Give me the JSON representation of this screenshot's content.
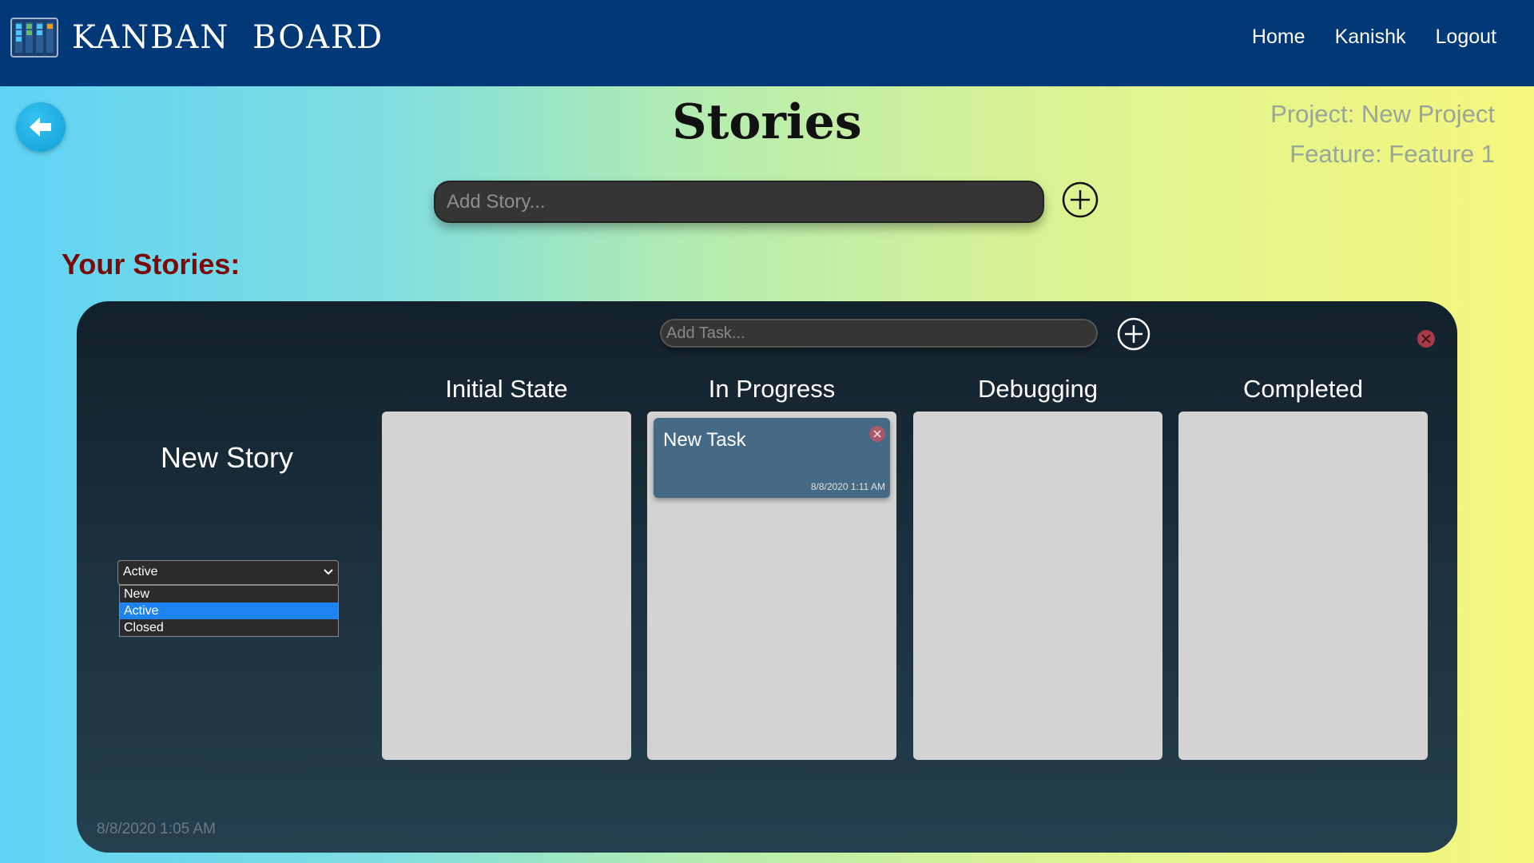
{
  "app": {
    "brand": "KANBAN BOARD",
    "nav": [
      {
        "label": "Home"
      },
      {
        "label": "Kanishk"
      },
      {
        "label": "Logout"
      }
    ]
  },
  "page": {
    "title": "Stories",
    "project": "Project: New Project",
    "feature": "Feature: Feature 1",
    "story_input_placeholder": "Add Story...",
    "section_heading": "Your Stories:"
  },
  "story": {
    "name": "New Story",
    "task_input_placeholder": "Add Task...",
    "status": {
      "selected": "Active",
      "options": [
        "New",
        "Active",
        "Closed"
      ]
    },
    "columns": [
      {
        "title": "Initial State"
      },
      {
        "title": "In Progress"
      },
      {
        "title": "Debugging"
      },
      {
        "title": "Completed"
      }
    ],
    "task": {
      "title": "New Task",
      "date": "8/8/2020 1:11 AM"
    },
    "created": "8/8/2020 1:05 AM"
  },
  "colors": {
    "navbar": "#013878",
    "heading": "#7a0a0a",
    "task_card": "#456a86",
    "selected_option": "#1e83f0"
  }
}
